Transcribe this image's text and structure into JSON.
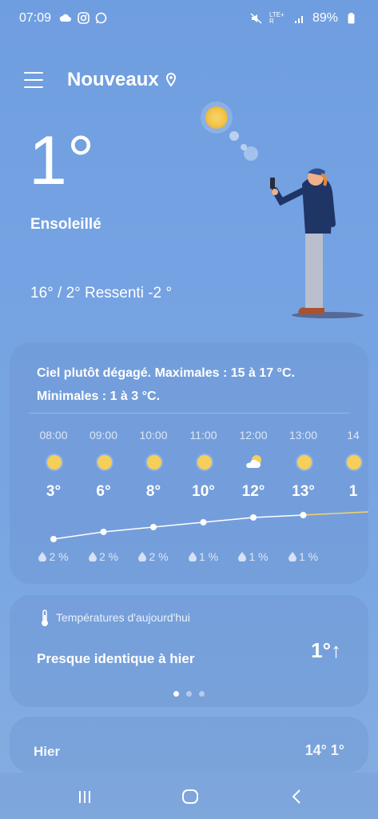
{
  "status": {
    "time": "07:09",
    "battery": "89%",
    "network": "LTE+ R",
    "icons": [
      "cloud-icon",
      "instagram-icon",
      "whatsapp-icon",
      "mute-icon",
      "signal-icon",
      "battery-icon"
    ]
  },
  "header": {
    "location": "Nouveaux"
  },
  "current": {
    "temperature": "1°",
    "condition": "Ensoleillé",
    "minmax": "16° / 2° Ressenti -2 °"
  },
  "forecast": {
    "summary": "Ciel plutôt dégagé. Maximales : 15 à 17 °C. Minimales : 1 à 3 °C.",
    "hours": [
      {
        "time": "08:00",
        "icon": "sun-icon",
        "temp": "3°",
        "rain": "2 %"
      },
      {
        "time": "09:00",
        "icon": "sun-icon",
        "temp": "6°",
        "rain": "2 %"
      },
      {
        "time": "10:00",
        "icon": "sun-icon",
        "temp": "8°",
        "rain": "2 %"
      },
      {
        "time": "11:00",
        "icon": "sun-icon",
        "temp": "10°",
        "rain": "1 %"
      },
      {
        "time": "12:00",
        "icon": "partly-cloudy-icon",
        "temp": "12°",
        "rain": "1 %"
      },
      {
        "time": "13:00",
        "icon": "sun-icon",
        "temp": "13°",
        "rain": "1 %"
      },
      {
        "time": "14",
        "icon": "sun-icon",
        "temp": "1",
        "rain": ""
      }
    ]
  },
  "today_card": {
    "title": "Températures d'aujourd'hui",
    "text": "Presque identique à hier",
    "value": "1°↑",
    "page_count": 3,
    "active_page": 0
  },
  "yesterday": {
    "label": "Hier",
    "values": "14°  1°"
  },
  "colors": {
    "sun": "#f5cf5a",
    "background_top": "#6f9ee0"
  }
}
